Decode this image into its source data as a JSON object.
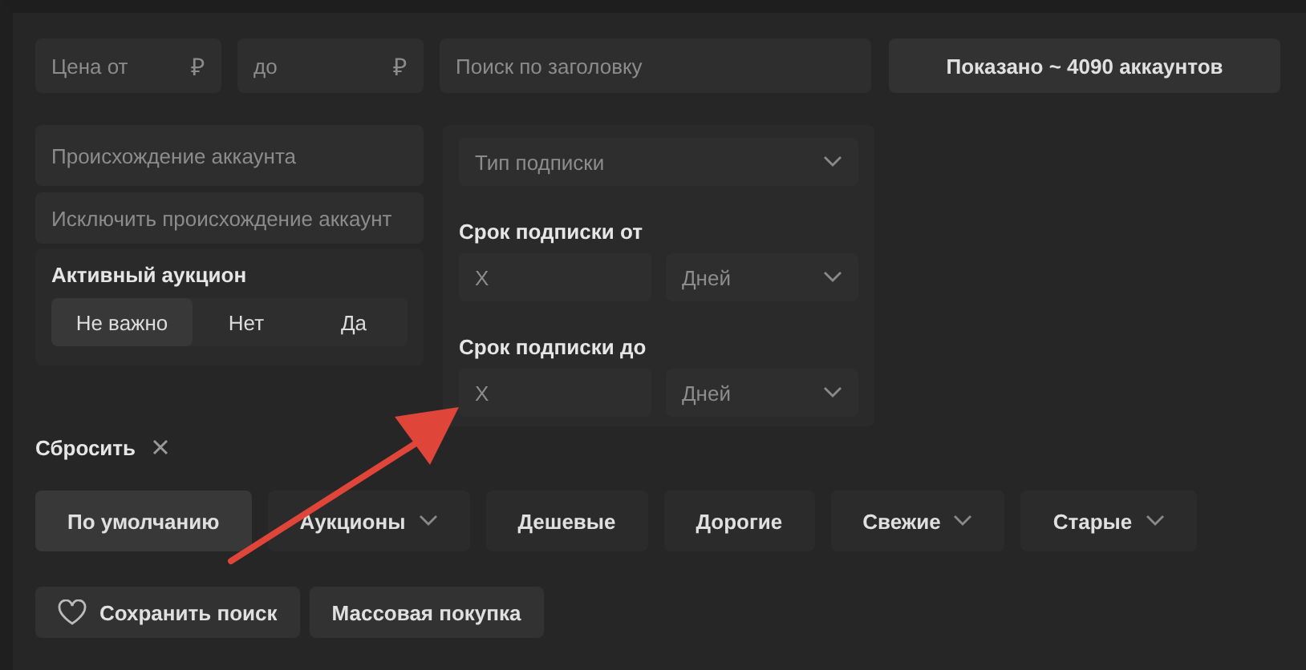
{
  "price_from": {
    "placeholder": "Цена от",
    "currency": "₽"
  },
  "price_to": {
    "placeholder": "до",
    "currency": "₽"
  },
  "title_search": {
    "placeholder": "Поиск по заголовку"
  },
  "shown_button": "Показано ~ 4090 аккаунтов",
  "origin": {
    "placeholder": "Происхождение аккаунта"
  },
  "exclude_origin": {
    "placeholder": "Исключить происхождение аккаунт"
  },
  "auction": {
    "title": "Активный аукцион",
    "options": [
      {
        "label": "Не важно",
        "selected": true
      },
      {
        "label": "Нет",
        "selected": false
      },
      {
        "label": "Да",
        "selected": false
      }
    ]
  },
  "subscription_type": {
    "placeholder": "Тип подписки"
  },
  "terms": [
    {
      "label": "Срок подписки от",
      "placeholder": "X",
      "unit": "Дней"
    },
    {
      "label": "Срок подписки до",
      "placeholder": "X",
      "unit": "Дней"
    }
  ],
  "reset": {
    "label": "Сбросить"
  },
  "sort": [
    {
      "label": "По умолчанию",
      "selected": true,
      "dropdown": false
    },
    {
      "label": "Аукционы",
      "selected": false,
      "dropdown": true
    },
    {
      "label": "Дешевые",
      "selected": false,
      "dropdown": false
    },
    {
      "label": "Дорогие",
      "selected": false,
      "dropdown": false
    },
    {
      "label": "Свежие",
      "selected": false,
      "dropdown": true
    },
    {
      "label": "Старые",
      "selected": false,
      "dropdown": true
    }
  ],
  "actions": [
    {
      "label": "Сохранить поиск",
      "kind": "save"
    },
    {
      "label": "Массовая покупка",
      "kind": "plain"
    }
  ]
}
